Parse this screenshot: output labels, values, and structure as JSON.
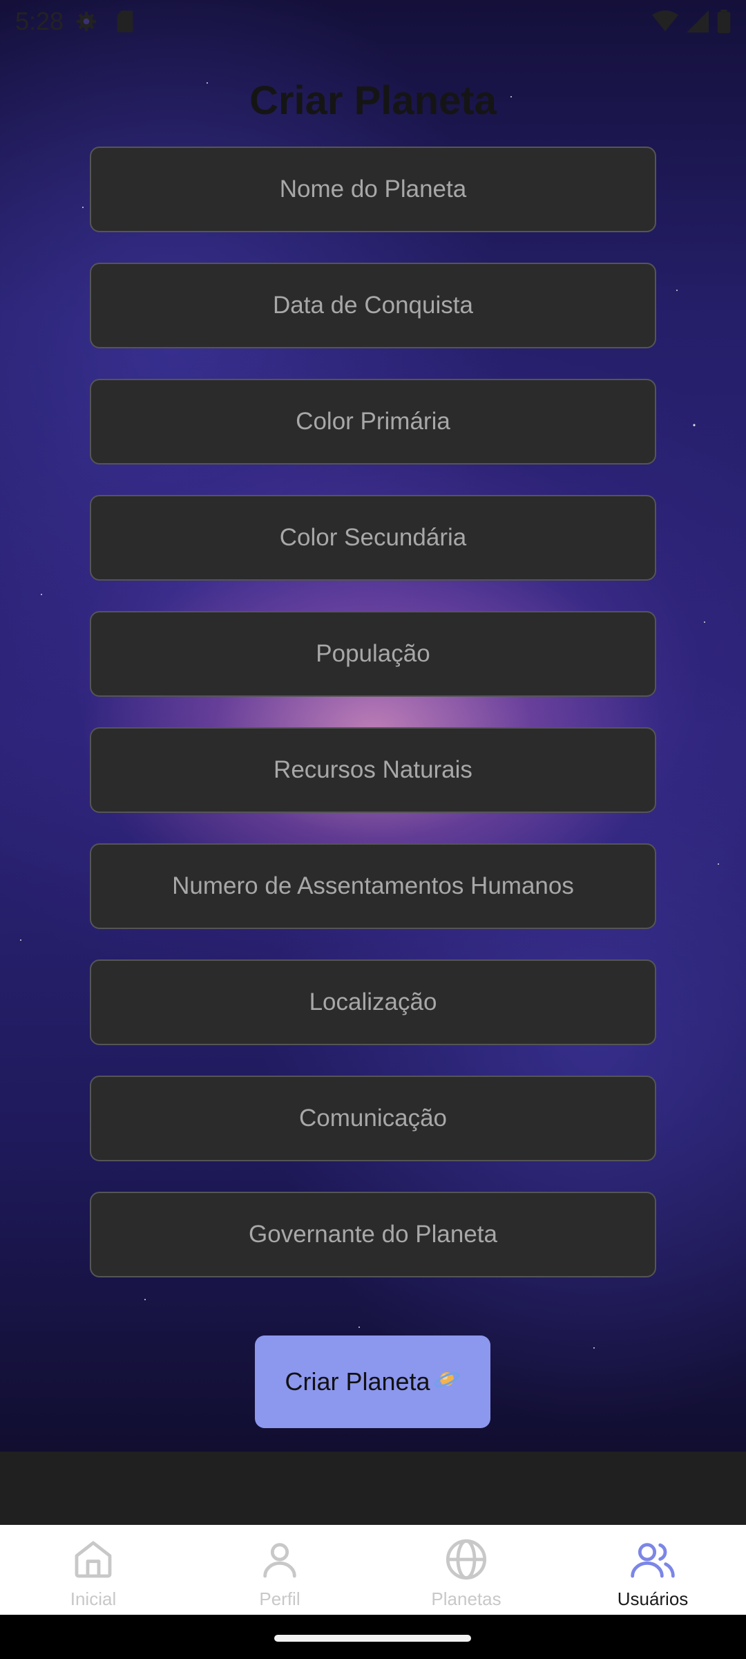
{
  "status_bar": {
    "time": "5:28"
  },
  "page": {
    "title": "Criar Planeta"
  },
  "form": {
    "fields": [
      {
        "placeholder": "Nome do Planeta"
      },
      {
        "placeholder": "Data de Conquista"
      },
      {
        "placeholder": "Color Primária"
      },
      {
        "placeholder": "Color Secundária"
      },
      {
        "placeholder": "População"
      },
      {
        "placeholder": "Recursos Naturais"
      },
      {
        "placeholder": "Numero de Assentamentos Humanos"
      },
      {
        "placeholder": "Localização"
      },
      {
        "placeholder": "Comunicação"
      },
      {
        "placeholder": "Governante do Planeta"
      }
    ],
    "submit_label": "Criar Planeta",
    "submit_icon": "ringed-planet-icon",
    "submit_color": "#8c97ee"
  },
  "bottom_nav": {
    "items": [
      {
        "label": "Inicial",
        "icon": "home-icon",
        "active": false
      },
      {
        "label": "Perfil",
        "icon": "user-icon",
        "active": false
      },
      {
        "label": "Planetas",
        "icon": "globe-icon",
        "active": false
      },
      {
        "label": "Usuários",
        "icon": "users-icon",
        "active": true
      }
    ],
    "active_color": "#7b86e6",
    "inactive_color": "#c8c8c8"
  }
}
